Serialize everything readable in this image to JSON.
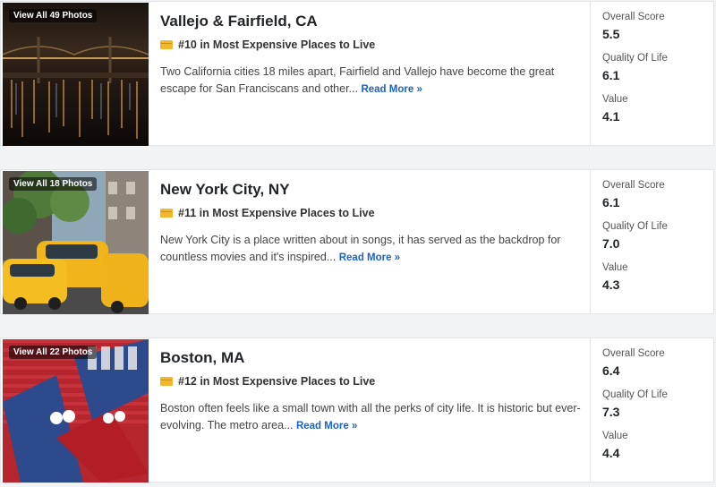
{
  "listings": [
    {
      "photo_label": "View All 49 Photos",
      "city": "Vallejo & Fairfield, CA",
      "rank": "#10 in Most Expensive Places to Live",
      "description": "Two California cities 18 miles apart, Fairfield and Vallejo have become the great escape for San Franciscans and other...",
      "read_more": "Read More »",
      "scores": [
        {
          "label": "Overall Score",
          "value": "5.5"
        },
        {
          "label": "Quality Of Life",
          "value": "6.1"
        },
        {
          "label": "Value",
          "value": "4.1"
        }
      ]
    },
    {
      "photo_label": "View All 18 Photos",
      "city": "New York City, NY",
      "rank": "#11 in Most Expensive Places to Live",
      "description": "New York City is a place written about in songs, it has served as the backdrop for countless movies and it's inspired...",
      "read_more": "Read More »",
      "scores": [
        {
          "label": "Overall Score",
          "value": "6.1"
        },
        {
          "label": "Quality Of Life",
          "value": "7.0"
        },
        {
          "label": "Value",
          "value": "4.3"
        }
      ]
    },
    {
      "photo_label": "View All 22 Photos",
      "city": "Boston, MA",
      "rank": "#12 in Most Expensive Places to Live",
      "description": "Boston often feels like a small town with all the perks of city life. It is historic but ever-evolving. The metro area...",
      "read_more": "Read More »",
      "scores": [
        {
          "label": "Overall Score",
          "value": "6.4"
        },
        {
          "label": "Quality Of Life",
          "value": "7.3"
        },
        {
          "label": "Value",
          "value": "4.4"
        }
      ]
    }
  ],
  "colors": {
    "link": "#1a63c7",
    "rank_badge": "#f2b62f",
    "page_background": "#f1f3f5"
  },
  "icons": {
    "rank_badge": "ticket-icon"
  }
}
